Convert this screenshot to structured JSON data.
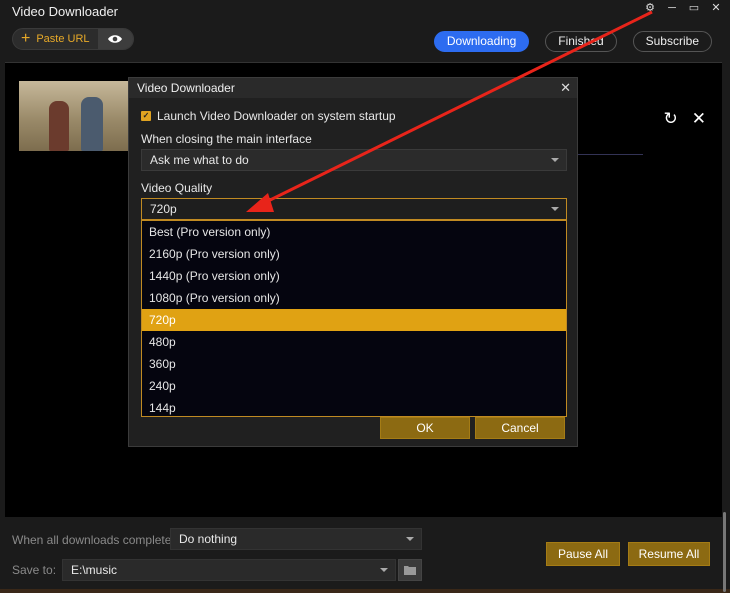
{
  "app": {
    "title": "Video Downloader"
  },
  "toolbar": {
    "paste_url_label": "Paste URL",
    "tabs": [
      {
        "label": "Downloading",
        "active": true
      },
      {
        "label": "Finished",
        "active": false
      },
      {
        "label": "Subscribe",
        "active": false
      }
    ]
  },
  "window_controls": {
    "settings": "gear-icon",
    "minimize": "minimize-icon",
    "maximize": "maximize-icon",
    "close": "close-icon"
  },
  "dialog": {
    "title": "Video Downloader",
    "startup_label": "Launch Video Downloader on system startup",
    "startup_checked": true,
    "closing_label": "When closing the main interface",
    "closing_value": "Ask me what to do",
    "quality_label": "Video Quality",
    "quality_value": "720p",
    "quality_options": [
      "Best (Pro version only)",
      "2160p (Pro version only)",
      "1440p (Pro version only)",
      "1080p (Pro version only)",
      "720p",
      "480p",
      "360p",
      "240p",
      "144p"
    ],
    "selected_index": 4,
    "ok_label": "OK",
    "cancel_label": "Cancel"
  },
  "bottom": {
    "complete_label": "When all downloads complete:",
    "complete_value": "Do nothing",
    "save_label": "Save to:",
    "save_value": "E:\\music",
    "pause_all_label": "Pause All",
    "resume_all_label": "Resume All"
  },
  "colors": {
    "accent": "#e0a213",
    "tab_active": "#2d6cf0",
    "annotation_arrow": "#e8241a"
  }
}
